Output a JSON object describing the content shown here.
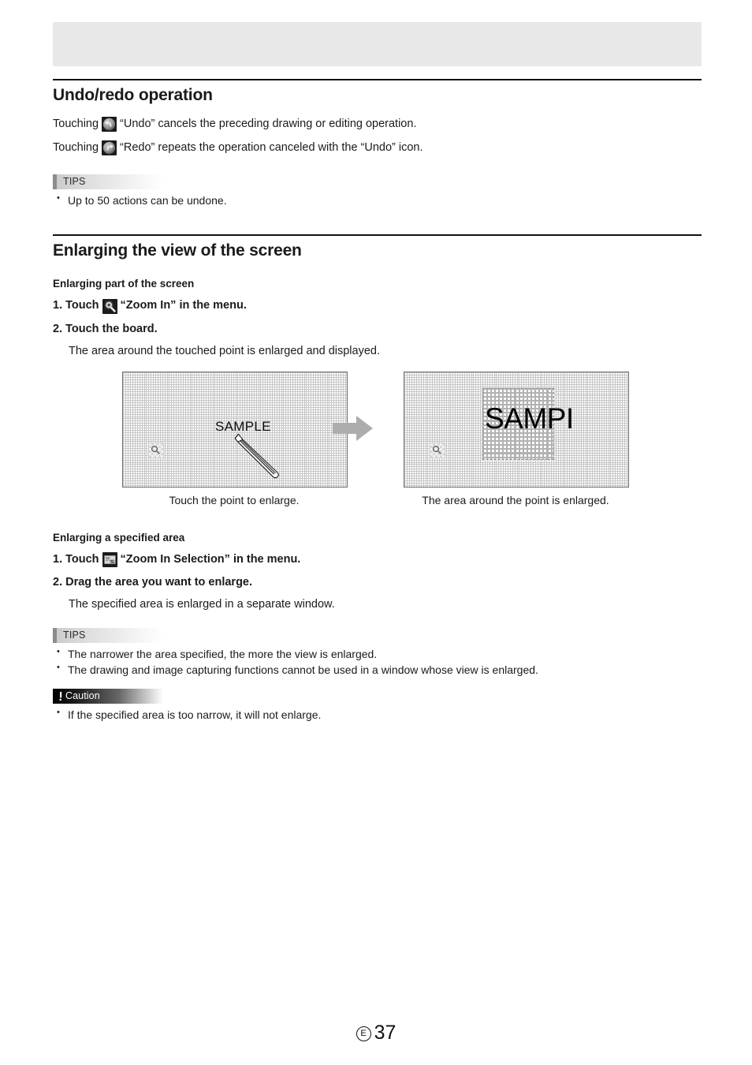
{
  "page": {
    "number": "37",
    "language_mark": "E"
  },
  "sections": [
    {
      "title": "Undo/redo operation",
      "lines": [
        {
          "pre": "Touching",
          "icon": "undo-icon",
          "post": "“Undo” cancels the preceding drawing or editing operation."
        },
        {
          "pre": "Touching",
          "icon": "redo-icon",
          "post": "“Redo” repeats the operation canceled with the “Undo” icon."
        }
      ],
      "tips": {
        "label": "TIPS",
        "items": [
          "Up to 50 actions can be undone."
        ]
      }
    },
    {
      "title": "Enlarging the view of the screen",
      "sub_a": {
        "heading": "Enlarging part of the screen",
        "step1_pre": "1. Touch",
        "step1_icon": "zoom-in-icon",
        "step1_post": "“Zoom In” in the menu.",
        "step2": "2. Touch the board.",
        "step2_detail": "The area around the touched point is enlarged and displayed."
      },
      "figure": {
        "left": {
          "board_text": "SAMPLE",
          "caption": "Touch the point to enlarge.",
          "tool_icon": "magnifier-tool-icon",
          "pen_icon": "pen-icon"
        },
        "arrow_icon": "right-arrow-icon",
        "right": {
          "board_text": "SAMPI",
          "caption": "The area around the point is enlarged.",
          "tool_icon": "magnifier-tool-icon"
        }
      },
      "sub_b": {
        "heading": "Enlarging a specified area",
        "step1_pre": "1. Touch",
        "step1_icon": "zoom-in-selection-icon",
        "step1_post": "“Zoom In Selection” in the menu.",
        "step2": "2. Drag the area you want to enlarge.",
        "step2_detail": "The specified area is enlarged in a separate window."
      },
      "tips": {
        "label": "TIPS",
        "items": [
          "The narrower the area specified, the more the view is enlarged.",
          "The drawing and image capturing functions cannot be used in a window whose view is enlarged."
        ]
      },
      "caution": {
        "label": "Caution",
        "items": [
          "If the specified area is too narrow, it will not enlarge."
        ]
      }
    }
  ],
  "colors": {
    "header_band": "#e8e8e8",
    "rule": "#111111",
    "tips_bar": "#8c8c8c",
    "caution_bg": "#000000",
    "arrow": "#adadad",
    "board_border": "#6f6f6f",
    "grid": "#bdbdbd"
  }
}
